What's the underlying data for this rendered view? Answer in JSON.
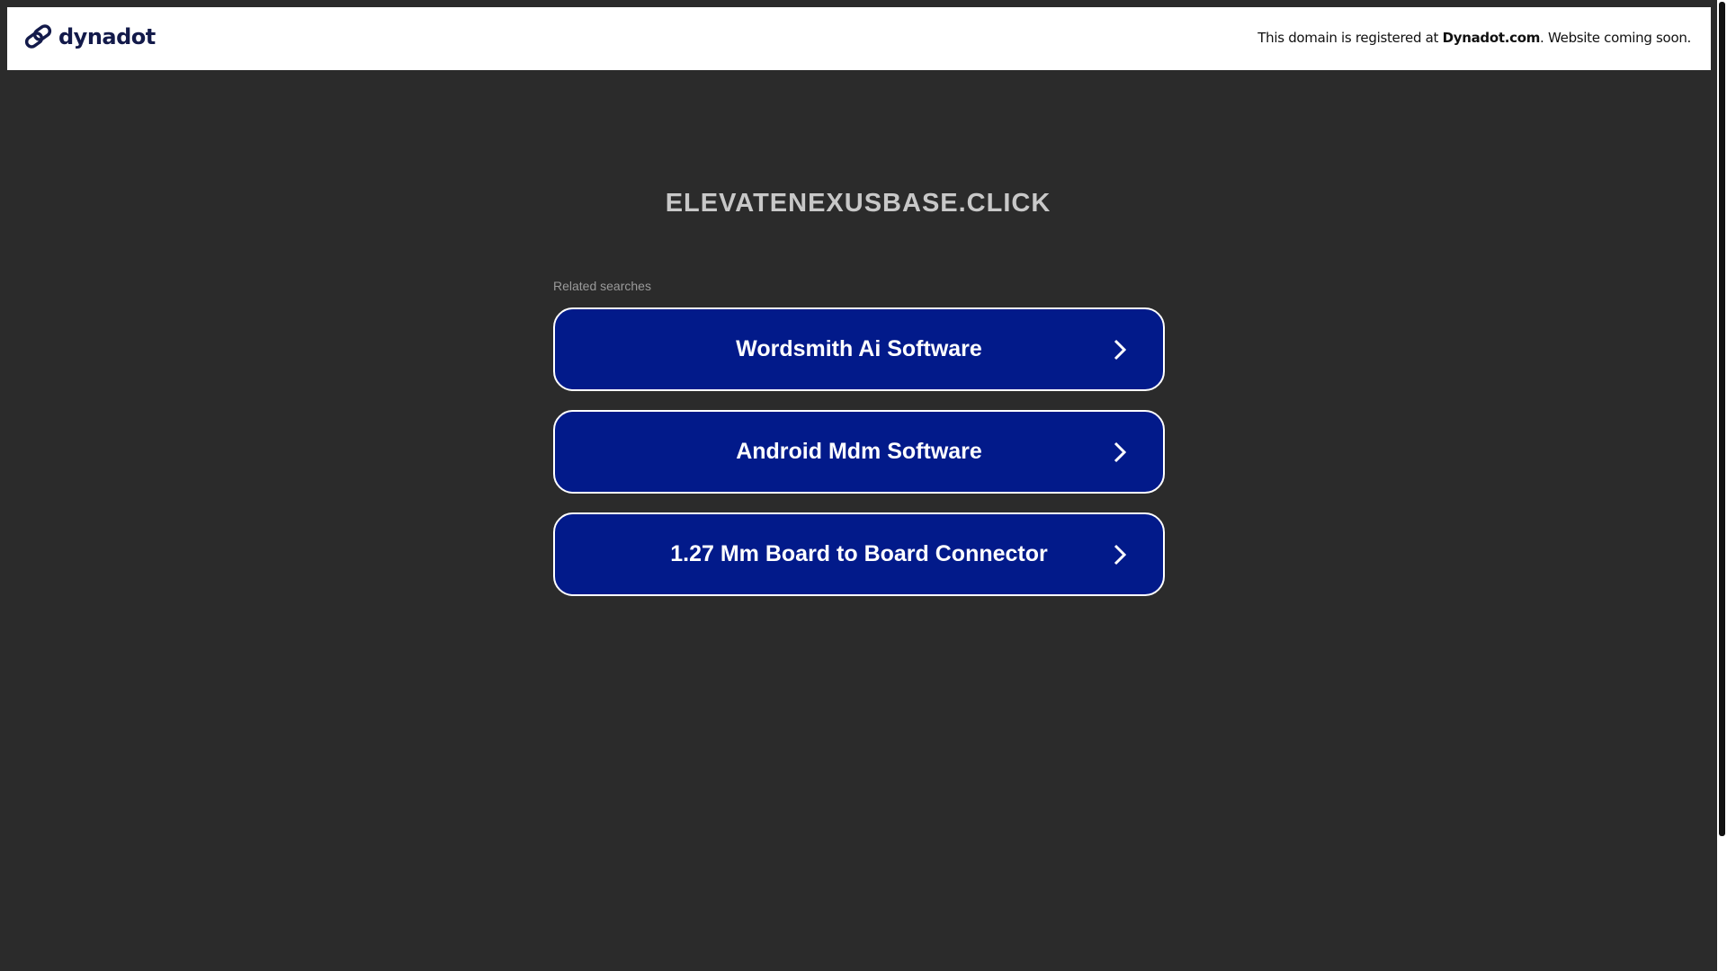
{
  "header": {
    "logo_text": "dynadot",
    "notice_prefix": "This domain is registered at ",
    "notice_brand": "Dynadot.com",
    "notice_suffix": ". Website coming soon."
  },
  "main": {
    "domain_title": "ELEVATENEXUSBASE.CLICK",
    "related_label": "Related searches",
    "searches": [
      {
        "label": "Wordsmith Ai Software"
      },
      {
        "label": "Android Mdm Software"
      },
      {
        "label": "1.27 Mm Board to Board Connector"
      }
    ]
  },
  "colors": {
    "background": "#2b2b2b",
    "button": "#021a8a",
    "logo": "#131a4a"
  }
}
